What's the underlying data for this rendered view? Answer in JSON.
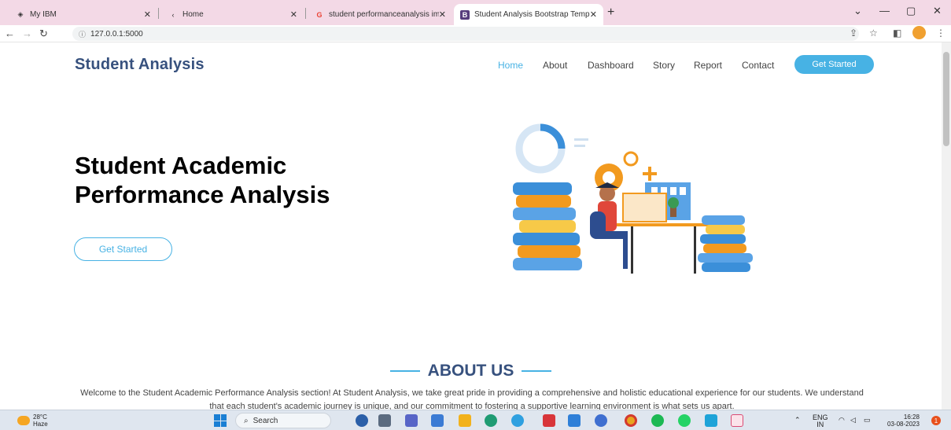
{
  "browser": {
    "tabs": [
      {
        "label": "My IBM",
        "icon": "ibm-icon"
      },
      {
        "label": "Home",
        "icon": "home-tab-icon"
      },
      {
        "label": "student performanceanalysis ima",
        "icon": "google-icon"
      },
      {
        "label": "Student Analysis Bootstrap Temp",
        "icon": "bootstrap-icon"
      }
    ],
    "url": "127.0.0.1:5000"
  },
  "nav": {
    "brand": "Student Analysis",
    "items": [
      "Home",
      "About",
      "Dashboard",
      "Story",
      "Report",
      "Contact"
    ],
    "active": "Home",
    "cta": "Get Started"
  },
  "hero": {
    "title": "Student Academic Performance Analysis",
    "button": "Get Started"
  },
  "about": {
    "title": "ABOUT US",
    "text": "Welcome to the Student Academic Performance Analysis section! At Student Analysis, we take great pride in providing a comprehensive and holistic educational experience for our students. We understand that each student's academic journey is unique, and our commitment to fostering a supportive learning environment is what sets us apart."
  },
  "taskbar": {
    "weather_temp": "28°C",
    "weather_desc": "Haze",
    "search": "Search",
    "lang": "ENG",
    "region": "IN",
    "time": "16:28",
    "date": "03-08-2023",
    "notifications": "1"
  },
  "colors": {
    "accent": "#47b2e4",
    "brand": "#37517e",
    "tabstrip": "#f3d9e6"
  }
}
